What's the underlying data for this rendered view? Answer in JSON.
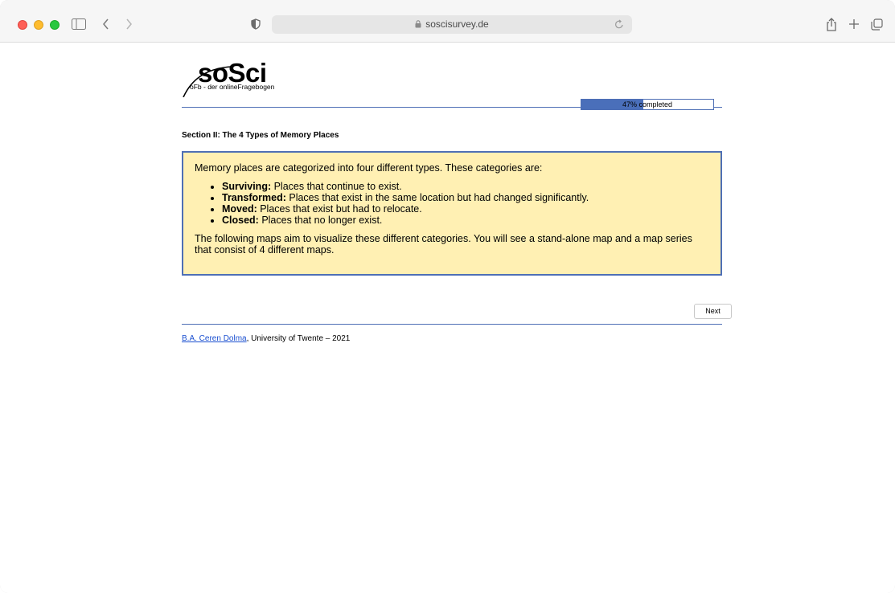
{
  "browser": {
    "address": "soscisurvey.de"
  },
  "logo": {
    "text": "soSci",
    "subtitle": "oFb - der onlineFragebogen"
  },
  "progress": {
    "percent": 47,
    "label": "47% completed"
  },
  "section": {
    "title": "Section II: The 4 Types of Memory Places"
  },
  "info": {
    "intro": "Memory places are categorized into four different types. These categories are:",
    "items": [
      {
        "term": "Surviving:",
        "desc": " Places that continue to exist."
      },
      {
        "term": "Transformed:",
        "desc": " Places that exist in the same location but had changed significantly."
      },
      {
        "term": "Moved:",
        "desc": " Places that exist but had to relocate."
      },
      {
        "term": "Closed:",
        "desc": " Places that no longer exist."
      }
    ],
    "outro": "The following maps aim to visualize these different categories. You will see a stand-alone map and a map series that consist of 4 different maps."
  },
  "nav": {
    "next_label": "Next"
  },
  "footer": {
    "author_link": "B.A. Ceren Dolma",
    "rest": ", University of Twente – 2021"
  },
  "colors": {
    "accent": "#4e6fb5",
    "info_bg": "#fff0b3"
  }
}
